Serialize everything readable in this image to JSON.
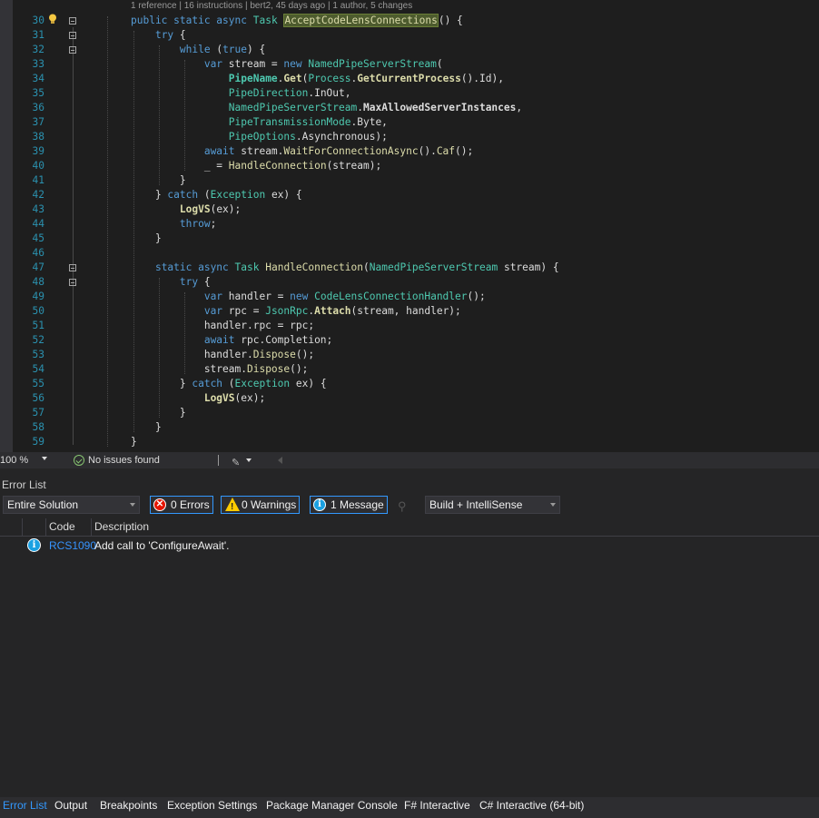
{
  "editor": {
    "codelens": "1 reference | 16 instructions | bert2, 45 days ago | 1 author, 5 changes",
    "line_numbers": [
      "30",
      "31",
      "32",
      "33",
      "34",
      "35",
      "36",
      "37",
      "38",
      "39",
      "40",
      "41",
      "42",
      "43",
      "44",
      "45",
      "46",
      "47",
      "48",
      "49",
      "50",
      "51",
      "52",
      "53",
      "54",
      "55",
      "56",
      "57",
      "58",
      "59"
    ],
    "lightbulb_icon": "lightbulb-icon"
  },
  "status": {
    "zoom": "100 %",
    "issues": "No issues found"
  },
  "error_list": {
    "title": "Error List",
    "scope": "Entire Solution",
    "errors_label": "0 Errors",
    "warnings_label": "0 Warnings",
    "messages_label": "1 Message",
    "build_filter": "Build + IntelliSense",
    "columns": {
      "code": "Code",
      "description": "Description"
    },
    "rows": [
      {
        "code": "RCS1090",
        "description": "Add call to 'ConfigureAwait'."
      }
    ]
  },
  "tabs": [
    "Error List",
    "Output",
    "Breakpoints",
    "Exception Settings",
    "Package Manager Console",
    "F# Interactive",
    "C# Interactive (64-bit)"
  ],
  "colors": {
    "accent": "#3399ff",
    "keyword": "#569cd6",
    "type": "#4ec9b0",
    "method": "#dcdcaa",
    "line_number": "#2b91af"
  }
}
